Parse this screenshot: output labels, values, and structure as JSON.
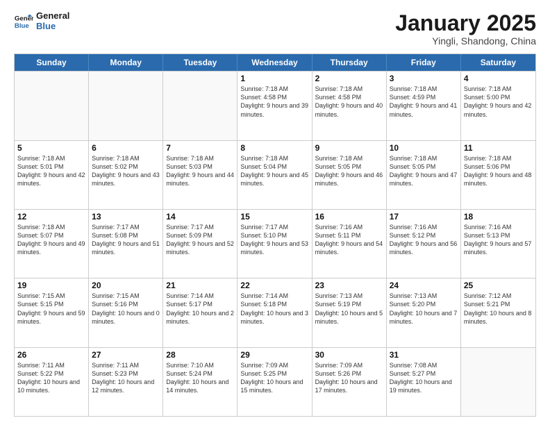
{
  "header": {
    "logo_line1": "General",
    "logo_line2": "Blue",
    "month_title": "January 2025",
    "subtitle": "Yingli, Shandong, China"
  },
  "weekdays": [
    "Sunday",
    "Monday",
    "Tuesday",
    "Wednesday",
    "Thursday",
    "Friday",
    "Saturday"
  ],
  "rows": [
    [
      {
        "day": "",
        "sunrise": "",
        "sunset": "",
        "daylight": ""
      },
      {
        "day": "",
        "sunrise": "",
        "sunset": "",
        "daylight": ""
      },
      {
        "day": "",
        "sunrise": "",
        "sunset": "",
        "daylight": ""
      },
      {
        "day": "1",
        "sunrise": "Sunrise: 7:18 AM",
        "sunset": "Sunset: 4:58 PM",
        "daylight": "Daylight: 9 hours and 39 minutes."
      },
      {
        "day": "2",
        "sunrise": "Sunrise: 7:18 AM",
        "sunset": "Sunset: 4:58 PM",
        "daylight": "Daylight: 9 hours and 40 minutes."
      },
      {
        "day": "3",
        "sunrise": "Sunrise: 7:18 AM",
        "sunset": "Sunset: 4:59 PM",
        "daylight": "Daylight: 9 hours and 41 minutes."
      },
      {
        "day": "4",
        "sunrise": "Sunrise: 7:18 AM",
        "sunset": "Sunset: 5:00 PM",
        "daylight": "Daylight: 9 hours and 42 minutes."
      }
    ],
    [
      {
        "day": "5",
        "sunrise": "Sunrise: 7:18 AM",
        "sunset": "Sunset: 5:01 PM",
        "daylight": "Daylight: 9 hours and 42 minutes."
      },
      {
        "day": "6",
        "sunrise": "Sunrise: 7:18 AM",
        "sunset": "Sunset: 5:02 PM",
        "daylight": "Daylight: 9 hours and 43 minutes."
      },
      {
        "day": "7",
        "sunrise": "Sunrise: 7:18 AM",
        "sunset": "Sunset: 5:03 PM",
        "daylight": "Daylight: 9 hours and 44 minutes."
      },
      {
        "day": "8",
        "sunrise": "Sunrise: 7:18 AM",
        "sunset": "Sunset: 5:04 PM",
        "daylight": "Daylight: 9 hours and 45 minutes."
      },
      {
        "day": "9",
        "sunrise": "Sunrise: 7:18 AM",
        "sunset": "Sunset: 5:05 PM",
        "daylight": "Daylight: 9 hours and 46 minutes."
      },
      {
        "day": "10",
        "sunrise": "Sunrise: 7:18 AM",
        "sunset": "Sunset: 5:05 PM",
        "daylight": "Daylight: 9 hours and 47 minutes."
      },
      {
        "day": "11",
        "sunrise": "Sunrise: 7:18 AM",
        "sunset": "Sunset: 5:06 PM",
        "daylight": "Daylight: 9 hours and 48 minutes."
      }
    ],
    [
      {
        "day": "12",
        "sunrise": "Sunrise: 7:18 AM",
        "sunset": "Sunset: 5:07 PM",
        "daylight": "Daylight: 9 hours and 49 minutes."
      },
      {
        "day": "13",
        "sunrise": "Sunrise: 7:17 AM",
        "sunset": "Sunset: 5:08 PM",
        "daylight": "Daylight: 9 hours and 51 minutes."
      },
      {
        "day": "14",
        "sunrise": "Sunrise: 7:17 AM",
        "sunset": "Sunset: 5:09 PM",
        "daylight": "Daylight: 9 hours and 52 minutes."
      },
      {
        "day": "15",
        "sunrise": "Sunrise: 7:17 AM",
        "sunset": "Sunset: 5:10 PM",
        "daylight": "Daylight: 9 hours and 53 minutes."
      },
      {
        "day": "16",
        "sunrise": "Sunrise: 7:16 AM",
        "sunset": "Sunset: 5:11 PM",
        "daylight": "Daylight: 9 hours and 54 minutes."
      },
      {
        "day": "17",
        "sunrise": "Sunrise: 7:16 AM",
        "sunset": "Sunset: 5:12 PM",
        "daylight": "Daylight: 9 hours and 56 minutes."
      },
      {
        "day": "18",
        "sunrise": "Sunrise: 7:16 AM",
        "sunset": "Sunset: 5:13 PM",
        "daylight": "Daylight: 9 hours and 57 minutes."
      }
    ],
    [
      {
        "day": "19",
        "sunrise": "Sunrise: 7:15 AM",
        "sunset": "Sunset: 5:15 PM",
        "daylight": "Daylight: 9 hours and 59 minutes."
      },
      {
        "day": "20",
        "sunrise": "Sunrise: 7:15 AM",
        "sunset": "Sunset: 5:16 PM",
        "daylight": "Daylight: 10 hours and 0 minutes."
      },
      {
        "day": "21",
        "sunrise": "Sunrise: 7:14 AM",
        "sunset": "Sunset: 5:17 PM",
        "daylight": "Daylight: 10 hours and 2 minutes."
      },
      {
        "day": "22",
        "sunrise": "Sunrise: 7:14 AM",
        "sunset": "Sunset: 5:18 PM",
        "daylight": "Daylight: 10 hours and 3 minutes."
      },
      {
        "day": "23",
        "sunrise": "Sunrise: 7:13 AM",
        "sunset": "Sunset: 5:19 PM",
        "daylight": "Daylight: 10 hours and 5 minutes."
      },
      {
        "day": "24",
        "sunrise": "Sunrise: 7:13 AM",
        "sunset": "Sunset: 5:20 PM",
        "daylight": "Daylight: 10 hours and 7 minutes."
      },
      {
        "day": "25",
        "sunrise": "Sunrise: 7:12 AM",
        "sunset": "Sunset: 5:21 PM",
        "daylight": "Daylight: 10 hours and 8 minutes."
      }
    ],
    [
      {
        "day": "26",
        "sunrise": "Sunrise: 7:11 AM",
        "sunset": "Sunset: 5:22 PM",
        "daylight": "Daylight: 10 hours and 10 minutes."
      },
      {
        "day": "27",
        "sunrise": "Sunrise: 7:11 AM",
        "sunset": "Sunset: 5:23 PM",
        "daylight": "Daylight: 10 hours and 12 minutes."
      },
      {
        "day": "28",
        "sunrise": "Sunrise: 7:10 AM",
        "sunset": "Sunset: 5:24 PM",
        "daylight": "Daylight: 10 hours and 14 minutes."
      },
      {
        "day": "29",
        "sunrise": "Sunrise: 7:09 AM",
        "sunset": "Sunset: 5:25 PM",
        "daylight": "Daylight: 10 hours and 15 minutes."
      },
      {
        "day": "30",
        "sunrise": "Sunrise: 7:09 AM",
        "sunset": "Sunset: 5:26 PM",
        "daylight": "Daylight: 10 hours and 17 minutes."
      },
      {
        "day": "31",
        "sunrise": "Sunrise: 7:08 AM",
        "sunset": "Sunset: 5:27 PM",
        "daylight": "Daylight: 10 hours and 19 minutes."
      },
      {
        "day": "",
        "sunrise": "",
        "sunset": "",
        "daylight": ""
      }
    ]
  ]
}
